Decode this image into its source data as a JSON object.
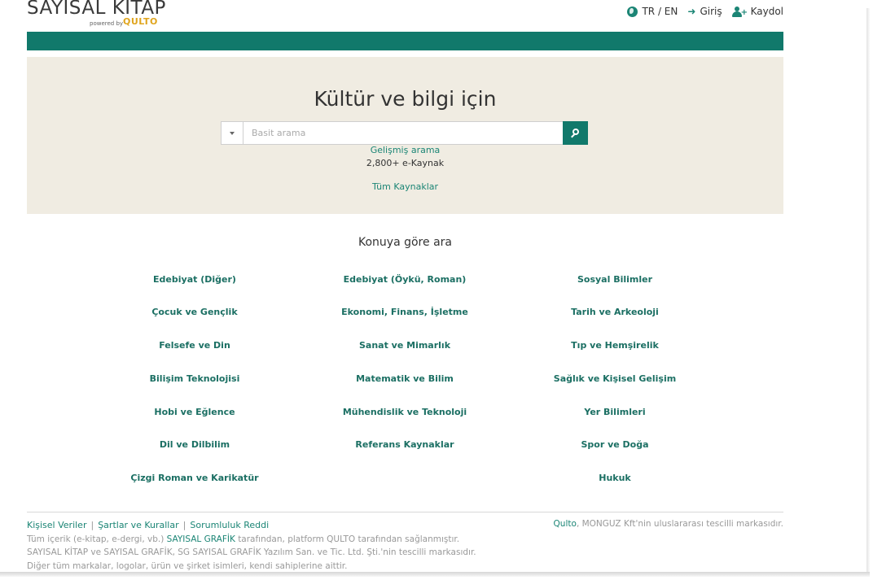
{
  "header": {
    "logo_title": "SAYISAL KITAP",
    "logo_sub": "powered by",
    "logo_brand": "QULTO",
    "lang_label": "TR / EN",
    "login_label": "Giriş",
    "register_label": "Kaydol"
  },
  "hero": {
    "title": "Kültür ve bilgi için",
    "search_placeholder": "Basit arama",
    "advanced_search": "Gelişmiş arama",
    "count": "2,800+ e-Kaynak",
    "all_sources": "Tüm Kaynaklar"
  },
  "topics": {
    "title": "Konuya göre ara",
    "col1": [
      "Edebiyat (Diğer)",
      "Çocuk ve Gençlik",
      "Felsefe ve Din",
      "Bilişim Teknolojisi",
      "Hobi ve Eğlence",
      "Dil ve Dilbilim",
      "Çizgi Roman ve Karikatür"
    ],
    "col2": [
      "Edebiyat (Öykü, Roman)",
      "Ekonomi, Finans, İşletme",
      "Sanat ve Mimarlık",
      "Matematik ve Bilim",
      "Mühendislik ve Teknoloji",
      "Referans Kaynaklar"
    ],
    "col3": [
      "Sosyal Bilimler",
      "Tarih ve Arkeoloji",
      "Tıp ve Hemşirelik",
      "Sağlık ve Kişisel Gelişim",
      "Yer Bilimleri",
      "Spor ve Doğa",
      "Hukuk"
    ]
  },
  "footer": {
    "link_privacy": "Kişisel Veriler",
    "link_terms": "Şartlar ve Kurallar",
    "link_disclaimer": "Sorumluluk Reddi",
    "line1_pre": "Tüm içerik (e-kitap, e-dergi, vb.)",
    "line1_brand": "SAYISAL GRAFİK",
    "line1_post": "tarafından, platform QULTO tarafından sağlanmıştır.",
    "line2": "SAYISAL KİTAP ve SAYISAL GRAFİK, SG SAYISAL GRAFİK Yazılım San. ve Tic. Ltd. Şti.'nin tescilli markasıdır.",
    "line3": "Diğer tüm markalar, logolar, ürün ve şirket isimleri, kendi sahiplerine aittir.",
    "right_brand": "Qulto",
    "right_text": ", MONGUZ Kft'nin uluslararası tescilli markasıdır."
  },
  "colors": {
    "accent": "#11796b",
    "hero_bg": "#f0ece2",
    "link": "#1b8575"
  }
}
